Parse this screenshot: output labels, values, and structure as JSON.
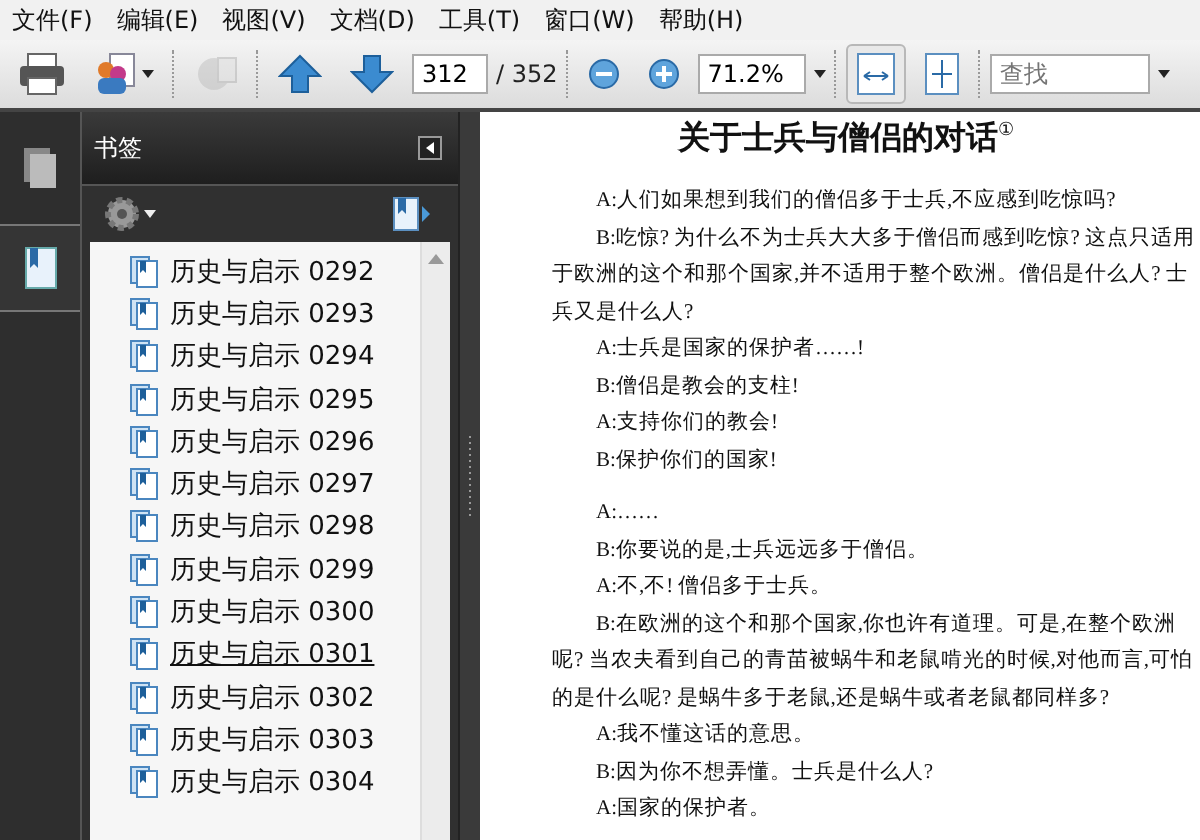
{
  "menu": [
    {
      "label": "文件(F)"
    },
    {
      "label": "编辑(E)"
    },
    {
      "label": "视图(V)"
    },
    {
      "label": "文档(D)"
    },
    {
      "label": "工具(T)"
    },
    {
      "label": "窗口(W)"
    },
    {
      "label": "帮助(H)"
    }
  ],
  "toolbar": {
    "page": "312",
    "page_total": "/ 352",
    "zoom": "71.2%",
    "search": {
      "placeholder": "查找"
    },
    "fit_width_selected": true,
    "fit_page_selected": false,
    "share_disabled": true
  },
  "sidebar": {
    "pages_selected": false,
    "bookmarks_selected": true,
    "title": "书签",
    "bookmarks": [
      {
        "label": "历史与启示 0292",
        "hovered": false
      },
      {
        "label": "历史与启示 0293",
        "hovered": false
      },
      {
        "label": "历史与启示 0294",
        "hovered": false
      },
      {
        "label": "历史与启示 0295",
        "hovered": false
      },
      {
        "label": "历史与启示 0296",
        "hovered": false
      },
      {
        "label": "历史与启示 0297",
        "hovered": false
      },
      {
        "label": "历史与启示 0298",
        "hovered": false
      },
      {
        "label": "历史与启示 0299",
        "hovered": false
      },
      {
        "label": "历史与启示 0300",
        "hovered": false
      },
      {
        "label": "历史与启示 0301",
        "hovered": true
      },
      {
        "label": "历史与启示 0302",
        "hovered": false
      },
      {
        "label": "历史与启示 0303",
        "hovered": false
      },
      {
        "label": "历史与启示 0304",
        "hovered": false
      }
    ]
  },
  "document": {
    "title": "关于士兵与僧侣的对话$^{①}$",
    "paragraphs": [
      {
        "kind": "text",
        "text": "A:人们如果想到我们的僧侣多于士兵,不应感到吃惊吗?"
      },
      {
        "kind": "text",
        "text": "B:吃惊? 为什么不为士兵大大多于僧侣而感到吃惊? 这点只适用于欧洲的这个和那个国家,并不适用于整个欧洲。僧侣是什么人? 士兵又是什么人?"
      },
      {
        "kind": "text",
        "text": "A:士兵是国家的保护者……!"
      },
      {
        "kind": "text",
        "text": "B:僧侣是教会的支柱!"
      },
      {
        "kind": "text",
        "text": "A:支持你们的教会!"
      },
      {
        "kind": "text",
        "text": "B:保护你们的国家!"
      },
      {
        "kind": "gap"
      },
      {
        "kind": "text",
        "text": "A:……"
      },
      {
        "kind": "text",
        "text": "B:你要说的是,士兵远远多于僧侣。"
      },
      {
        "kind": "text",
        "text": "A:不,不! 僧侣多于士兵。"
      },
      {
        "kind": "text",
        "text": "B:在欧洲的这个和那个国家,你也许有道理。可是,在整个欧洲呢? 当农夫看到自己的青苗被蜗牛和老鼠啃光的时候,对他而言,可怕的是什么呢? 是蜗牛多于老鼠,还是蜗牛或者老鼠都同样多?"
      },
      {
        "kind": "text",
        "text": "A:我不懂这话的意思。"
      },
      {
        "kind": "text",
        "text": "B:因为你不想弄懂。士兵是什么人?"
      },
      {
        "kind": "text",
        "text": "A:国家的保护者。"
      }
    ]
  }
}
